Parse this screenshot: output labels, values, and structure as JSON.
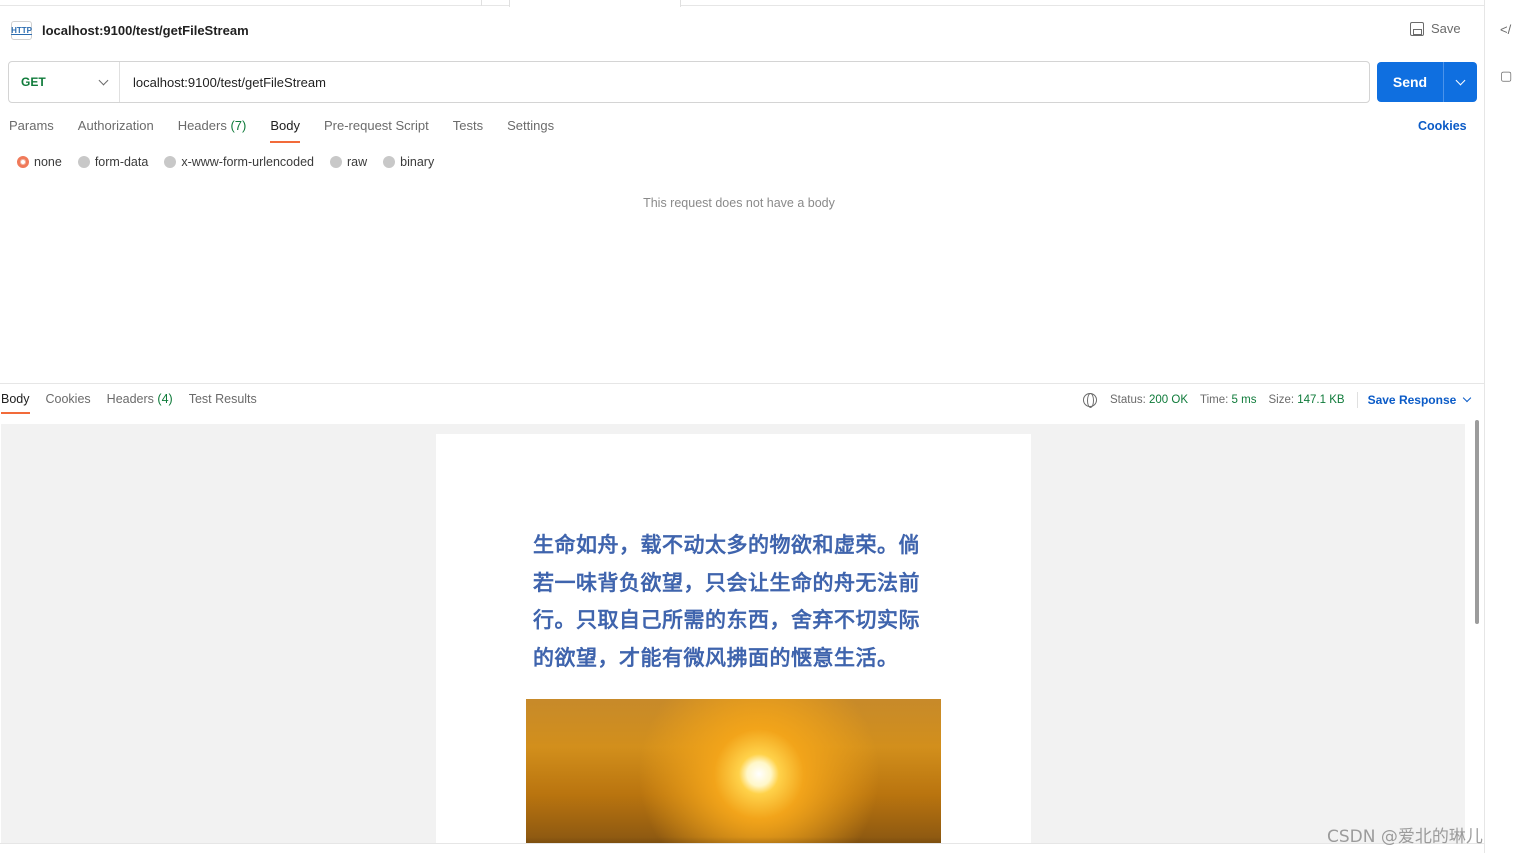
{
  "request": {
    "title": "localhost:9100/test/getFileStream",
    "http_icon": "HTTP",
    "save_label": "Save",
    "method": "GET",
    "url": "localhost:9100/test/getFileStream",
    "send_label": "Send"
  },
  "request_tabs": [
    {
      "label": "Params"
    },
    {
      "label": "Authorization"
    },
    {
      "label": "Headers",
      "count": "(7)"
    },
    {
      "label": "Body"
    },
    {
      "label": "Pre-request Script"
    },
    {
      "label": "Tests"
    },
    {
      "label": "Settings"
    }
  ],
  "cookies_label": "Cookies",
  "body_types": [
    "none",
    "form-data",
    "x-www-form-urlencoded",
    "raw",
    "binary"
  ],
  "selected_body_type": "none",
  "no_body_message": "This request does not have a body",
  "response": {
    "tabs": [
      {
        "label": "Body"
      },
      {
        "label": "Cookies"
      },
      {
        "label": "Headers",
        "count": "(4)"
      },
      {
        "label": "Test Results"
      }
    ],
    "status_label": "Status:",
    "status_value": "200 OK",
    "time_label": "Time:",
    "time_value": "5 ms",
    "size_label": "Size:",
    "size_value": "147.1 KB",
    "save_response_label": "Save Response"
  },
  "preview_image": {
    "poem_lines": [
      "生命如舟，载不动太多的物欲和虚荣。倘",
      "若一味背负欲望，只会让生命的舟无法前",
      "行。只取自己所需的东西，舍弃不切实际",
      "的欲望，才能有微风拂面的惬意生活。"
    ],
    "poem_color": "#3f64ad"
  },
  "watermark": "CSDN @爱北的琳儿",
  "colors": {
    "accent_tab": "#f26b3a",
    "send_button": "#0f6fe0",
    "method_get": "#0f7b3a",
    "link_blue": "#0b5bc7"
  },
  "icons": [
    "http-file-icon",
    "save-disk-icon",
    "chevron-down-icon",
    "globe-icon",
    "code-icon",
    "info-panel-icon"
  ]
}
